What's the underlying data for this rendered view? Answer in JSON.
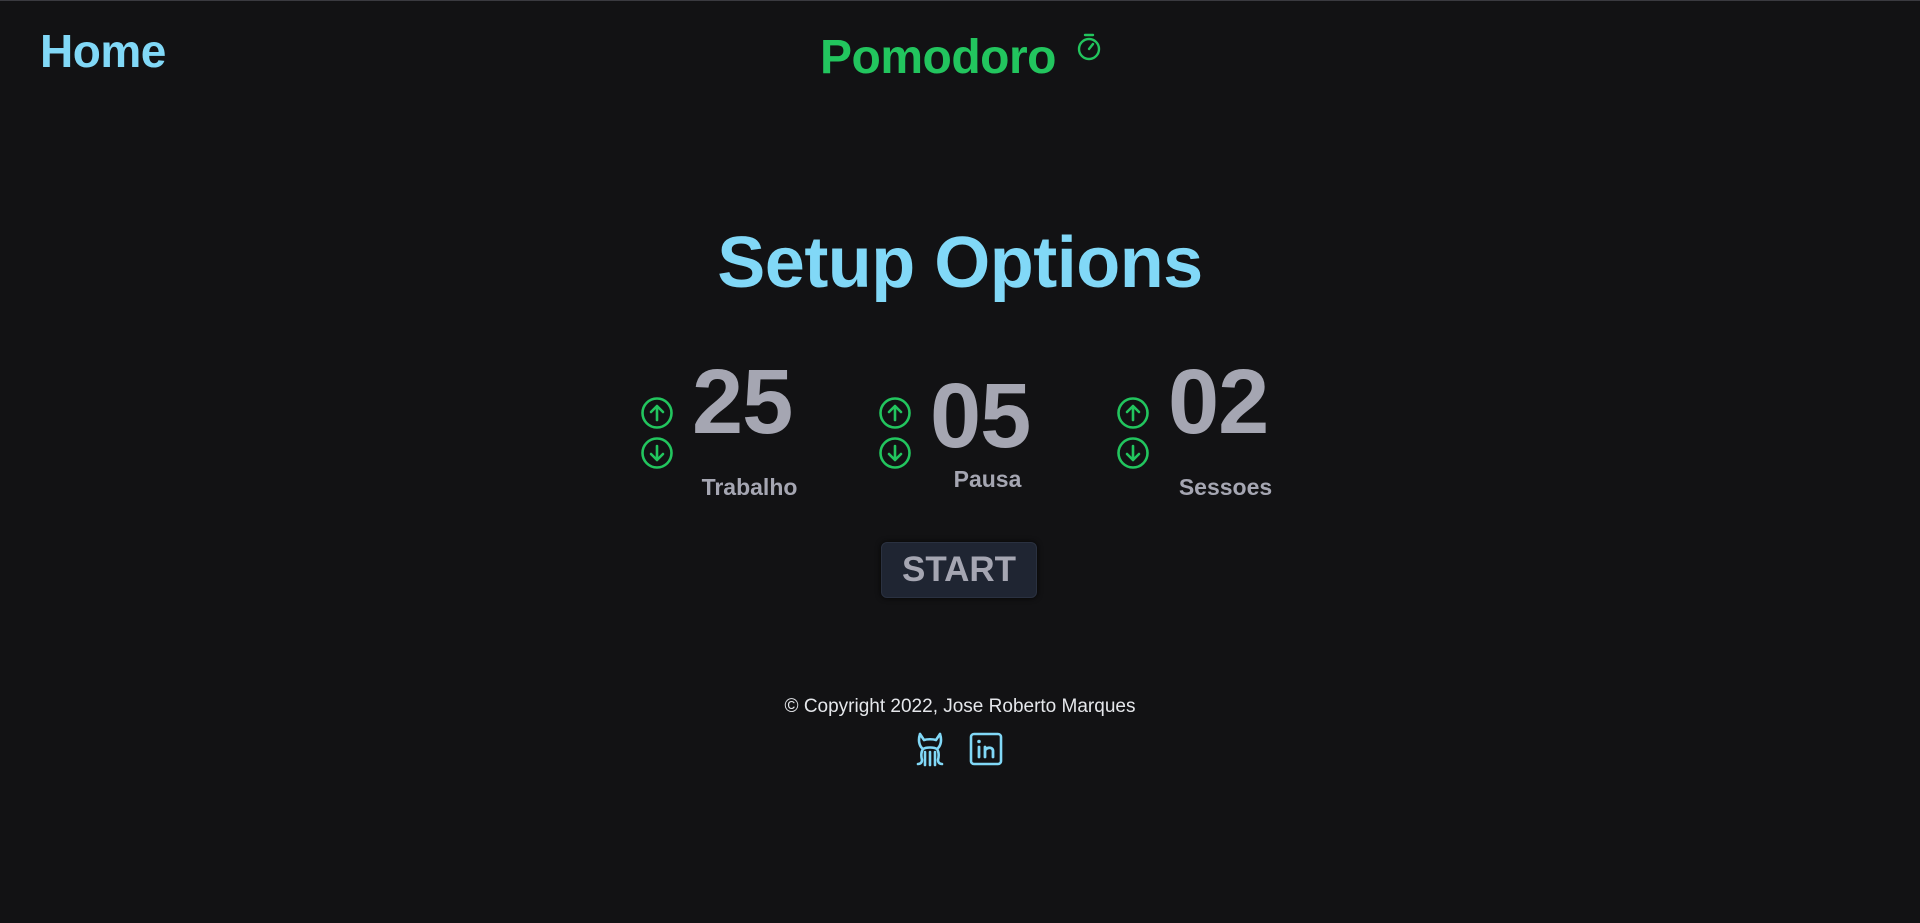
{
  "nav": {
    "home_label": "Home",
    "brand_title": "Pomodoro",
    "brand_icon": "stopwatch-icon"
  },
  "setup": {
    "title": "Setup Options",
    "options": [
      {
        "value": "25",
        "label": "Trabalho"
      },
      {
        "value": "05",
        "label": "Pausa"
      },
      {
        "value": "02",
        "label": "Sessoes"
      }
    ],
    "start_label": "START"
  },
  "footer": {
    "copyright": "© Copyright 2022, Jose Roberto Marques",
    "links": [
      {
        "icon": "github-icon"
      },
      {
        "icon": "linkedin-icon"
      }
    ]
  },
  "colors": {
    "background": "#121214",
    "accent_blue": "#81d8f7",
    "accent_green": "#22c55e",
    "muted_text": "#a5a6b2",
    "button_bg": "#1f2532"
  }
}
